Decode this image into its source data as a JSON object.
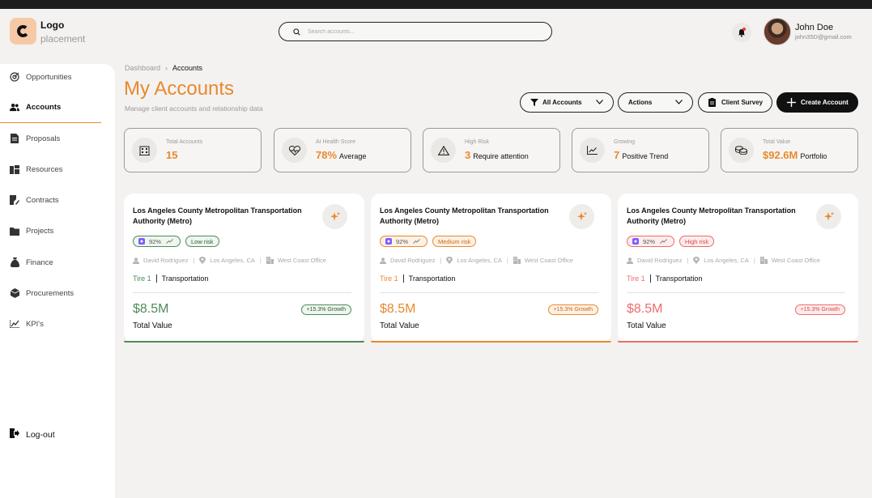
{
  "header": {
    "logo_line1": "Logo",
    "logo_line2": "placement",
    "search_placeholder": "Search accounts...",
    "user_name": "John Doe",
    "user_email": "john35D@gmail.com"
  },
  "sidebar": {
    "items": [
      {
        "label": "Opportunities",
        "icon": "target-icon"
      },
      {
        "label": "Accounts",
        "icon": "users-icon",
        "active": true
      },
      {
        "label": "Proposals",
        "icon": "document-icon"
      },
      {
        "label": "Resources",
        "icon": "resources-icon"
      },
      {
        "label": "Contracts",
        "icon": "contract-icon"
      },
      {
        "label": "Projects",
        "icon": "folder-icon"
      },
      {
        "label": "Finance",
        "icon": "money-bag-icon"
      },
      {
        "label": "Procurements",
        "icon": "box-icon"
      },
      {
        "label": "KPI's",
        "icon": "chart-icon"
      }
    ],
    "logout_label": "Log-out"
  },
  "breadcrumb": {
    "root": "Dashboard",
    "current": "Accounts"
  },
  "page": {
    "title": "My Accounts",
    "subtitle": "Manage client accounts and relationship data"
  },
  "toolbar": {
    "filter_label": "All Accounts",
    "actions_label": "Actions",
    "survey_label": "Client Survey",
    "create_label": "Create Account"
  },
  "stats": [
    {
      "label": "Total Accounts",
      "value": "15",
      "suffix": "",
      "icon": "building-icon"
    },
    {
      "label": "AI Health Score",
      "value": "78%",
      "suffix": "Average",
      "icon": "heart-pulse-icon"
    },
    {
      "label": "High Risk",
      "value": "3",
      "suffix": "Require attention",
      "icon": "warning-icon"
    },
    {
      "label": "Growing",
      "value": "7",
      "suffix": "Positive Trend",
      "icon": "trend-up-icon"
    },
    {
      "label": "Total Value",
      "value": "$92.6M",
      "suffix": "Portfolio",
      "icon": "coins-icon"
    }
  ],
  "accounts": [
    {
      "title": "Los Angeles County Metropolitan Transportation Authority (Metro)",
      "score": "92%",
      "risk": "Low risk",
      "owner": "David Rodriguez",
      "location": "Los Angeles, CA",
      "office": "West Coast Office",
      "tier": "Tire 1",
      "sector": "Transportation",
      "amount": "$8.5M",
      "value_label": "Total Value",
      "growth": "+15.3% Growth",
      "accent": "#4f8a5b"
    },
    {
      "title": "Los Angeles County Metropolitan Transportation Authority (Metro)",
      "score": "92%",
      "risk": "Medium risk",
      "owner": "David Rodriguez",
      "location": "Los Angeles, CA",
      "office": "West Coast Office",
      "tier": "Tire 1",
      "sector": "Transportation",
      "amount": "$8.5M",
      "value_label": "Total Value",
      "growth": "+15.3% Growth",
      "accent": "#e8892e"
    },
    {
      "title": "Los Angeles County Metropolitan Transportation Authority (Metro)",
      "score": "92%",
      "risk": "High risk",
      "owner": "David Rodriguez",
      "location": "Los Angeles, CA",
      "office": "West Coast Office",
      "tier": "Tire 1",
      "sector": "Transportation",
      "amount": "$8.5M",
      "value_label": "Total Value",
      "growth": "+15.3% Growth",
      "accent": "#ee6b6b"
    }
  ],
  "colors": {
    "brand": "#e8892e",
    "score_purple": "#7c5cff"
  }
}
